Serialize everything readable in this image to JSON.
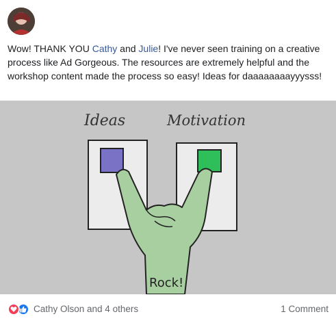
{
  "post": {
    "text_before_1": "Wow! THANK YOU ",
    "mention_1": "Cathy",
    "text_between": " and ",
    "mention_2": "Julie",
    "text_after": "! I've never seen training on a creative process like Ad Gorgeous. The resources are extremely helpful and the workshop content made the process so easy! Ideas for daaaaaaaayyysss!"
  },
  "image": {
    "label_left": "Ideas",
    "label_right": "Motivation",
    "wrist_text": "Rock!",
    "colors": {
      "background": "#c6c6c6",
      "panel": "#ececec",
      "button_left": "#7a72c4",
      "button_right": "#2fbf5a",
      "hand": "#a8cfa0"
    }
  },
  "footer": {
    "reaction_summary": "Cathy Olson and 4 others",
    "comments": "1 Comment",
    "reaction_icons": [
      "love-icon",
      "like-icon"
    ]
  }
}
